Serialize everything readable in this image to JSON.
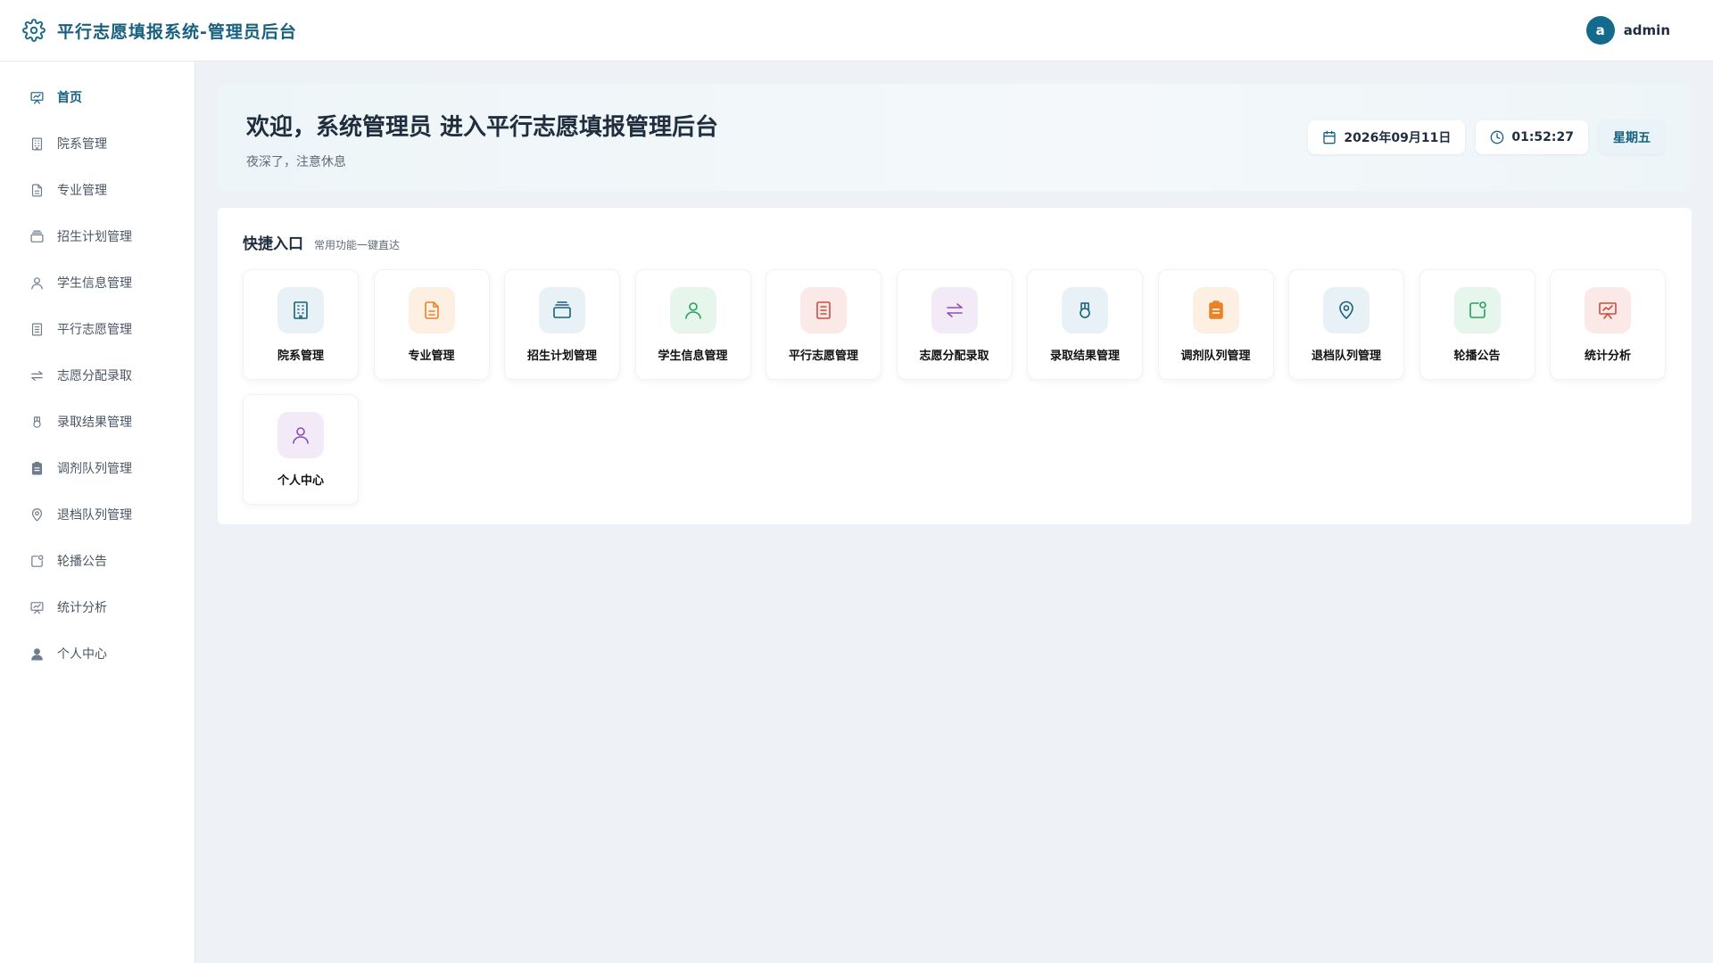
{
  "header": {
    "title": "平行志愿填报系统-管理员后台",
    "logo_icon": "gear-icon",
    "avatar_letter": "a",
    "username": "admin",
    "accent": "#17607f"
  },
  "sidebar": {
    "items": [
      {
        "label": "首页",
        "icon": "chart-board-icon",
        "active": true
      },
      {
        "label": "院系管理",
        "icon": "building-icon"
      },
      {
        "label": "专业管理",
        "icon": "document-icon"
      },
      {
        "label": "招生计划管理",
        "icon": "stack-icon"
      },
      {
        "label": "学生信息管理",
        "icon": "user-icon"
      },
      {
        "label": "平行志愿管理",
        "icon": "list-document-icon"
      },
      {
        "label": "志愿分配录取",
        "icon": "swap-icon"
      },
      {
        "label": "录取结果管理",
        "icon": "medal-icon"
      },
      {
        "label": "调剂队列管理",
        "icon": "clipboard-icon"
      },
      {
        "label": "退档队列管理",
        "icon": "location-pin-icon"
      },
      {
        "label": "轮播公告",
        "icon": "notification-icon"
      },
      {
        "label": "统计分析",
        "icon": "chart-board-icon"
      },
      {
        "label": "个人中心",
        "icon": "user-filled-icon"
      }
    ]
  },
  "welcome": {
    "title": "欢迎，系统管理员 进入平行志愿填报管理后台",
    "subtitle": "夜深了，注意休息",
    "date": "2026年09月11日",
    "time": "01:52:27",
    "weekday": "星期五"
  },
  "quick": {
    "title": "快捷入口",
    "subtitle": "常用功能一键直达",
    "cards": [
      {
        "label": "院系管理",
        "icon": "building-icon",
        "color": "#17607f",
        "bg": "#e8f1f6"
      },
      {
        "label": "专业管理",
        "icon": "document-icon",
        "color": "#e8832a",
        "bg": "#fdf0e3"
      },
      {
        "label": "招生计划管理",
        "icon": "stack-icon",
        "color": "#17607f",
        "bg": "#e8f1f6"
      },
      {
        "label": "学生信息管理",
        "icon": "user-icon",
        "color": "#27a05a",
        "bg": "#e6f6ec"
      },
      {
        "label": "平行志愿管理",
        "icon": "list-document-icon",
        "color": "#d04a3e",
        "bg": "#fbe9e7"
      },
      {
        "label": "志愿分配录取",
        "icon": "swap-icon",
        "color": "#8e4cb5",
        "bg": "#f3eaf8"
      },
      {
        "label": "录取结果管理",
        "icon": "medal-icon",
        "color": "#17607f",
        "bg": "#e8f1f6"
      },
      {
        "label": "调剂队列管理",
        "icon": "clipboard-icon",
        "color": "#e8832a",
        "bg": "#fdf0e3"
      },
      {
        "label": "退档队列管理",
        "icon": "location-pin-icon",
        "color": "#17607f",
        "bg": "#e8f1f6"
      },
      {
        "label": "轮播公告",
        "icon": "notification-icon",
        "color": "#27a05a",
        "bg": "#e6f6ec"
      },
      {
        "label": "统计分析",
        "icon": "chart-board-icon",
        "color": "#d04a3e",
        "bg": "#fbe9e7"
      },
      {
        "label": "个人中心",
        "icon": "user-icon",
        "color": "#8e4cb5",
        "bg": "#f3eaf8"
      }
    ]
  }
}
